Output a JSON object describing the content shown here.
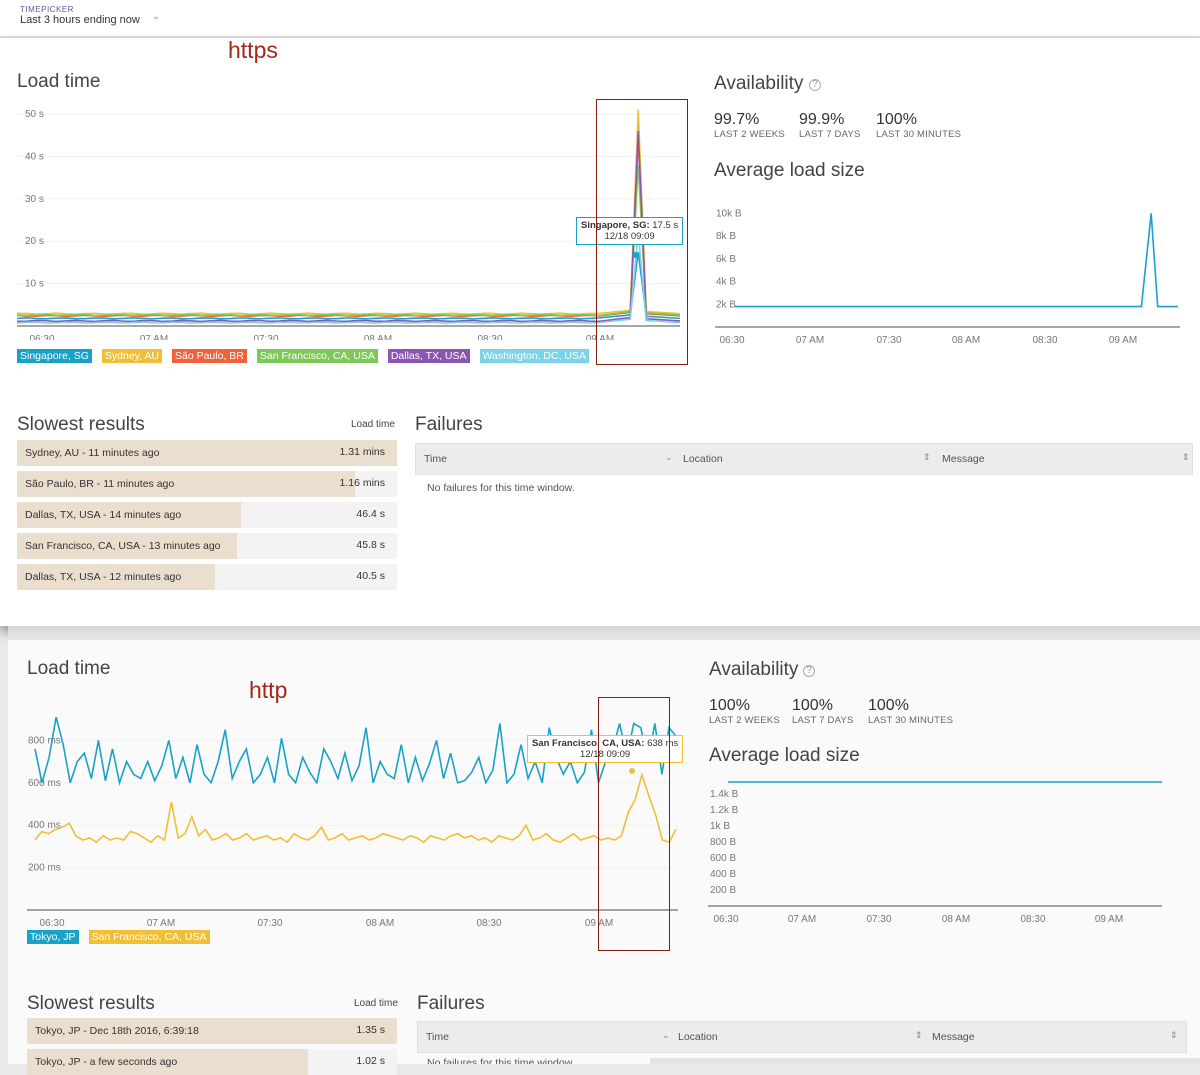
{
  "timepicker": {
    "label": "TIMEPICKER",
    "value": "Last 3 hours ending now"
  },
  "https": {
    "annotation": "https",
    "load_time_title": "Load time",
    "availability_title": "Availability",
    "availability": [
      {
        "value": "99.7%",
        "label": "LAST 2 WEEKS"
      },
      {
        "value": "99.9%",
        "label": "LAST 7 DAYS"
      },
      {
        "value": "100%",
        "label": "LAST 30 MINUTES"
      }
    ],
    "load_size_title": "Average load size",
    "tooltip": {
      "location": "Singapore, SG:",
      "value": "17.5 s",
      "time": "12/18 09:09"
    },
    "legend": [
      {
        "name": "Singapore, SG",
        "color": "#19a2c7"
      },
      {
        "name": "Sydney, AU",
        "color": "#f0bf36"
      },
      {
        "name": "São Paulo, BR",
        "color": "#f0623a"
      },
      {
        "name": "San Francisco, CA, USA",
        "color": "#7cc957"
      },
      {
        "name": "Dallas, TX, USA",
        "color": "#8d55b3"
      },
      {
        "name": "Washington, DC, USA",
        "color": "#7bd3ea"
      }
    ],
    "slowest_title": "Slowest results",
    "slowest_col": "Load time",
    "slowest": [
      {
        "label": "Sydney, AU - 11 minutes ago",
        "value": "1.31 mins",
        "fill": 1.0
      },
      {
        "label": "São Paulo, BR - 11 minutes ago",
        "value": "1.16 mins",
        "fill": 0.89
      },
      {
        "label": "Dallas, TX, USA - 14 minutes ago",
        "value": "46.4 s",
        "fill": 0.59
      },
      {
        "label": "San Francisco, CA, USA - 13 minutes ago",
        "value": "45.8 s",
        "fill": 0.58
      },
      {
        "label": "Dallas, TX, USA - 12 minutes ago",
        "value": "40.5 s",
        "fill": 0.52
      }
    ],
    "failures_title": "Failures",
    "failures_cols": [
      "Time",
      "Location",
      "Message"
    ],
    "failures_empty": "No failures for this time window."
  },
  "http": {
    "annotation": "http",
    "load_time_title": "Load time",
    "availability_title": "Availability",
    "availability": [
      {
        "value": "100%",
        "label": "LAST 2 WEEKS"
      },
      {
        "value": "100%",
        "label": "LAST 7 DAYS"
      },
      {
        "value": "100%",
        "label": "LAST 30 MINUTES"
      }
    ],
    "load_size_title": "Average load size",
    "tooltip": {
      "location": "San Francisco, CA, USA:",
      "value": "638 ms",
      "time": "12/18 09:09"
    },
    "legend": [
      {
        "name": "Tokyo, JP",
        "color": "#19a2c7"
      },
      {
        "name": "San Francisco, CA, USA",
        "color": "#f0bf36"
      }
    ],
    "slowest_title": "Slowest results",
    "slowest_col": "Load time",
    "slowest": [
      {
        "label": "Tokyo, JP - Dec 18th 2016, 6:39:18",
        "value": "1.35 s",
        "fill": 1.0
      },
      {
        "label": "Tokyo, JP - a few seconds ago",
        "value": "1.02 s",
        "fill": 0.76
      }
    ],
    "failures_title": "Failures",
    "failures_cols": [
      "Time",
      "Location",
      "Message"
    ],
    "failures_empty": "No failures for this time window."
  },
  "chart_data": [
    {
      "type": "line",
      "title": "Load time",
      "x_ticks": [
        "06:30",
        "07 AM",
        "07:30",
        "08 AM",
        "08:30",
        "09 AM"
      ],
      "y_ticks": [
        "10 s",
        "20 s",
        "30 s",
        "40 s",
        "50 s"
      ],
      "ylim": [
        0,
        50
      ],
      "series": [
        {
          "name": "Singapore, SG",
          "color": "#19a2c7",
          "baseline": 1.8,
          "peak": 17.5
        },
        {
          "name": "Sydney, AU",
          "color": "#f0bf36",
          "baseline": 2.9,
          "peak": 51
        },
        {
          "name": "São Paulo, BR",
          "color": "#f0623a",
          "baseline": 2.4,
          "peak": 44
        },
        {
          "name": "San Francisco, CA, USA",
          "color": "#7cc957",
          "baseline": 2.6,
          "peak": 38
        },
        {
          "name": "Dallas, TX, USA",
          "color": "#8d55b3",
          "baseline": 1.2,
          "peak": 46
        },
        {
          "name": "Washington, DC, USA",
          "color": "#7bd3ea",
          "baseline": 0.8,
          "peak": 22
        }
      ]
    },
    {
      "type": "line",
      "title": "Average load size",
      "x_ticks": [
        "06:30",
        "07 AM",
        "07:30",
        "08 AM",
        "08:30",
        "09 AM"
      ],
      "y_ticks": [
        "2k B",
        "4k B",
        "6k B",
        "8k B",
        "10k B"
      ],
      "ylim": [
        0,
        11000
      ],
      "series": [
        {
          "name": "",
          "color": "#19a2c7",
          "baseline": 1800,
          "peak": 10000
        }
      ]
    },
    {
      "type": "line",
      "title": "Load time",
      "x_ticks": [
        "06:30",
        "07 AM",
        "07:30",
        "08 AM",
        "08:30",
        "09 AM"
      ],
      "y_ticks": [
        "200 ms",
        "400 ms",
        "600 ms",
        "800 ms"
      ],
      "ylim": [
        0,
        1000
      ],
      "series": [
        {
          "name": "Tokyo, JP",
          "color": "#19a2c7",
          "values": [
            760,
            600,
            720,
            910,
            780,
            600,
            700,
            740,
            620,
            800,
            610,
            760,
            600,
            700,
            640,
            620,
            700,
            610,
            680,
            800,
            620,
            720,
            600,
            780,
            640,
            600,
            700,
            850,
            620,
            700,
            760,
            600,
            640,
            720,
            600,
            810,
            640,
            600,
            720,
            650,
            600,
            760,
            700,
            620,
            740,
            610,
            680,
            860,
            600,
            700,
            640,
            620,
            780,
            600,
            720,
            610,
            690,
            800,
            620,
            740,
            600,
            610,
            650,
            720,
            600,
            660,
            880,
            600,
            640,
            780,
            620,
            700,
            600,
            860,
            720,
            640,
            700,
            600,
            650,
            850,
            600,
            700,
            760,
            880,
            720,
            880,
            860,
            700,
            880,
            640,
            860,
            820
          ]
        },
        {
          "name": "San Francisco, CA, USA",
          "color": "#f0bf36",
          "values": [
            330,
            370,
            360,
            380,
            390,
            410,
            350,
            330,
            340,
            320,
            350,
            330,
            340,
            330,
            370,
            360,
            340,
            320,
            350,
            330,
            510,
            340,
            360,
            440,
            350,
            380,
            330,
            340,
            360,
            330,
            340,
            360,
            330,
            340,
            350,
            330,
            340,
            320,
            360,
            340,
            330,
            350,
            390,
            330,
            340,
            360,
            330,
            340,
            350,
            330,
            340,
            360,
            350,
            340,
            330,
            350,
            340,
            320,
            350,
            340,
            330,
            350,
            360,
            340,
            350,
            330,
            340,
            320,
            350,
            340,
            330,
            350,
            400,
            330,
            340,
            360,
            330,
            320,
            340,
            360,
            330,
            340,
            350,
            330,
            340,
            330,
            350,
            460,
            520,
            638,
            540,
            450,
            330,
            320,
            380
          ]
        }
      ]
    },
    {
      "type": "line",
      "title": "Average load size",
      "x_ticks": [
        "06:30",
        "07 AM",
        "07:30",
        "08 AM",
        "08:30",
        "09 AM"
      ],
      "y_ticks": [
        "200 B",
        "400 B",
        "600 B",
        "800 B",
        "1k B",
        "1.2k B",
        "1.4k B"
      ],
      "ylim": [
        0,
        1600
      ],
      "series": [
        {
          "name": "",
          "color": "#19a2c7",
          "baseline": 1550
        }
      ]
    }
  ]
}
